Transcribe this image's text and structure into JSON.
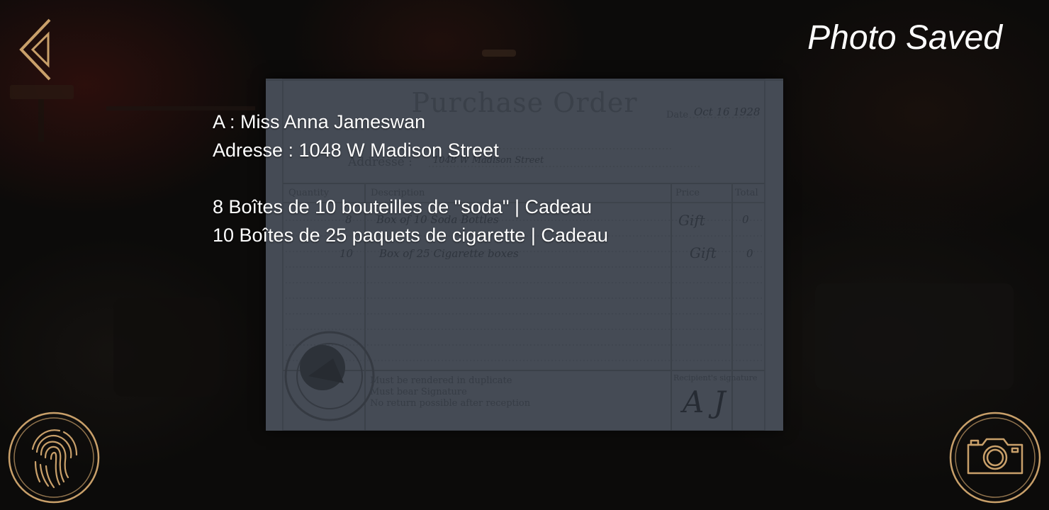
{
  "hud": {
    "status_message": "Photo Saved",
    "back_icon": "back-arrow-icon",
    "fingerprint_icon": "fingerprint-icon",
    "camera_icon": "camera-icon",
    "accent_color": "#c9a06a"
  },
  "translation": {
    "recipient": "A : Miss Anna Jameswan",
    "address": "Adresse : 1048 W Madison Street",
    "items": [
      "8 Boîtes de 10 bouteilles de \"soda\" | Cadeau",
      "10 Boîtes de 25 paquets de cigarette | Cadeau"
    ]
  },
  "document": {
    "title": "Purchase Order",
    "date_label": "Date",
    "date_value": "Oct 16 1928",
    "address_label": "Addresse :",
    "address_value": "1048 W Madison Street",
    "columns": [
      "Quantity",
      "Description",
      "Price",
      "Total"
    ],
    "rows": [
      {
        "quantity": "8",
        "description": "Box of 10 Soda Bottles",
        "price": "Gift",
        "total": "0"
      },
      {
        "quantity": "10",
        "description": "Box of 25 Cigarette boxes",
        "price": "Gift",
        "total": "0"
      }
    ],
    "notes": [
      "Must be rendered in duplicate",
      "Must bear Signature",
      "No return possible after reception"
    ],
    "signature_label": "Recipient's signature",
    "signature": "A J",
    "stamp_text": "CHICAGO'S SODA INCORPORATION",
    "stamp_since": "SINCE"
  }
}
